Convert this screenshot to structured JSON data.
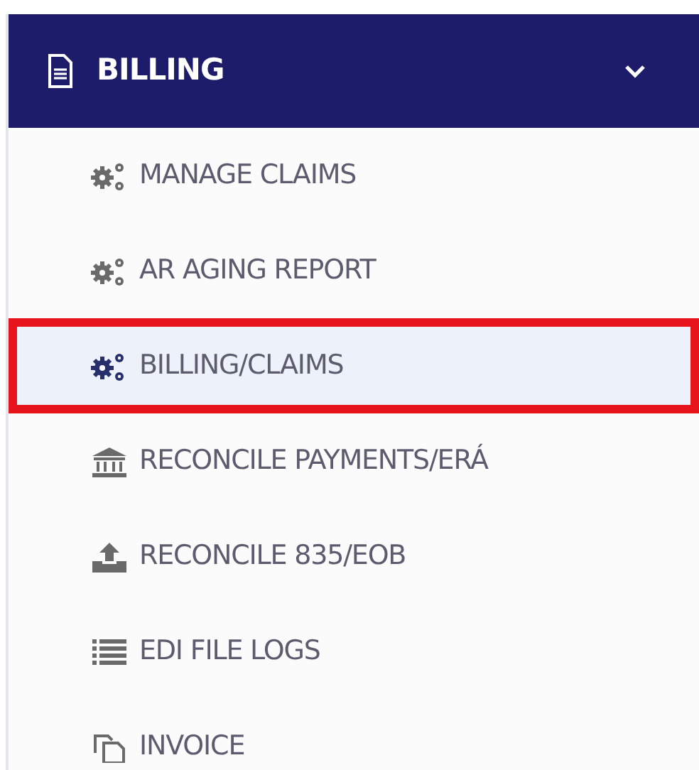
{
  "menu_header": {
    "title": "BILLING",
    "expanded": true
  },
  "items": [
    {
      "label": "MANAGE CLAIMS",
      "kind": "gears",
      "selected": false,
      "outlined": false
    },
    {
      "label": "AR AGING REPORT",
      "kind": "gears",
      "selected": false,
      "outlined": false
    },
    {
      "label": "BILLING/CLAIMS",
      "kind": "gears",
      "selected": true,
      "outlined": true
    },
    {
      "label": "RECONCILE PAYMENTS/ERÁ",
      "kind": "bank",
      "selected": false,
      "outlined": false
    },
    {
      "label": "RECONCILE 835/EOB",
      "kind": "upload",
      "selected": false,
      "outlined": false
    },
    {
      "label": "EDI FILE LOGS",
      "kind": "list",
      "selected": false,
      "outlined": false
    },
    {
      "label": "INVOICE",
      "kind": "copy",
      "selected": false,
      "outlined": false
    }
  ]
}
